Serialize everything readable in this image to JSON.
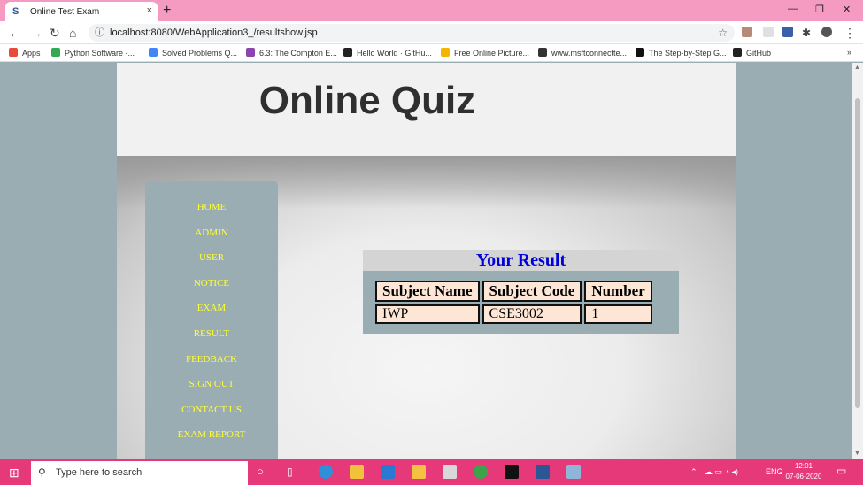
{
  "browser": {
    "tab_title": "Online Test Exam",
    "tab_close": "×",
    "new_tab": "+",
    "url": "localhost:8080/WebApplication3_/resultshow.jsp",
    "window_controls": {
      "minimize": "—",
      "restore": "❐",
      "close": "✕"
    }
  },
  "bookmarks": [
    {
      "label": "Apps",
      "color": "#e84b3c"
    },
    {
      "label": "Python Software -...",
      "color": "#34a853"
    },
    {
      "label": "Solved Problems Q...",
      "color": "#4285f4"
    },
    {
      "label": "6.3: The Compton E...",
      "color": "#8e44ad"
    },
    {
      "label": "Hello World · GitHu...",
      "color": "#222222"
    },
    {
      "label": "Free Online Picture...",
      "color": "#f4b400"
    },
    {
      "label": "www.msftconnectte...",
      "color": "#333333"
    },
    {
      "label": "The Step-by-Step G...",
      "color": "#111111"
    },
    {
      "label": "GitHub",
      "color": "#222222"
    }
  ],
  "bookmarks_more": "»",
  "site": {
    "title": "Online Quiz"
  },
  "nav": [
    "HOME",
    "ADMIN",
    "USER",
    "NOTICE",
    "EXAM",
    "RESULT",
    "FEEDBACK",
    "SIGN OUT",
    "CONTACT US",
    "EXAM REPORT"
  ],
  "result": {
    "heading": "Your Result",
    "columns": [
      "Subject Name",
      "Subject Code",
      "Number"
    ],
    "rows": [
      [
        "IWP",
        "CSE3002",
        "1"
      ]
    ]
  },
  "taskbar": {
    "search_placeholder": "Type here to search",
    "language": "ENG",
    "time": "12:01",
    "date": "07-06-2020"
  },
  "colors": {
    "tab_bar": "#f59ac0",
    "taskbar": "#e6397a",
    "page_bg": "#9aadb3",
    "nav_link": "#ffff33",
    "result_heading": "#0000dd",
    "cell_bg": "#fde6d6"
  }
}
